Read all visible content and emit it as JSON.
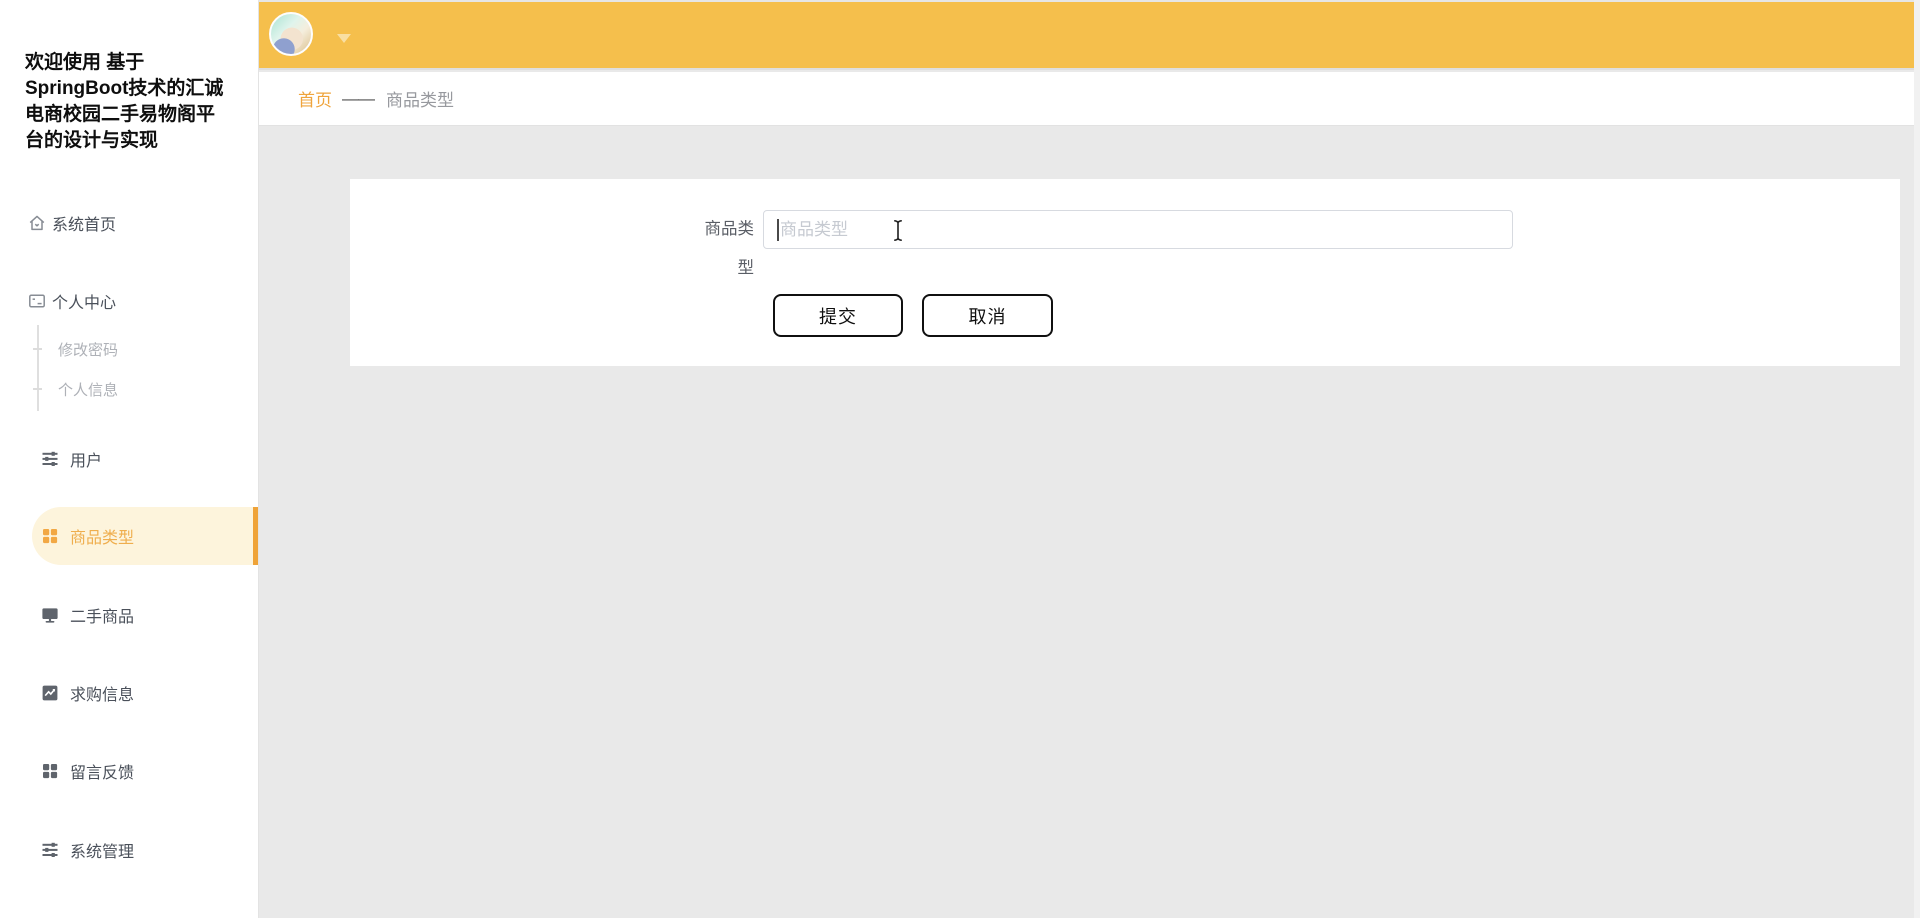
{
  "sidebar": {
    "title": "欢迎使用 基于SpringBoot技术的汇诚电商校园二手易物阁平台的设计与实现",
    "items": [
      {
        "label": "系统首页",
        "icon": "home-icon"
      },
      {
        "label": "个人中心",
        "icon": "postcard-icon",
        "children": [
          "修改密码",
          "个人信息"
        ]
      },
      {
        "label": "用户",
        "icon": "operation-icon"
      },
      {
        "label": "商品类型",
        "icon": "grid-menu-icon",
        "active": true
      },
      {
        "label": "二手商品",
        "icon": "monitor-icon"
      },
      {
        "label": "求购信息",
        "icon": "trend-chart-icon"
      },
      {
        "label": "留言反馈",
        "icon": "grid-menu-icon"
      },
      {
        "label": "系统管理",
        "icon": "operation-icon"
      }
    ]
  },
  "header": {
    "avatar": "user-avatar",
    "dropdown_caret": "caret-down"
  },
  "breadcrumb": {
    "home": "首页",
    "separator": "——",
    "current": "商品类型"
  },
  "form": {
    "label": "商品类型",
    "input_value": "",
    "input_placeholder": "商品类型",
    "submit_label": "提交",
    "cancel_label": "取消"
  },
  "colors": {
    "topbar": "#F5BF4C",
    "active_pill_bg": "#FDF4DC",
    "active_text": "#EFAE4E",
    "accent_bar": "#EFA338",
    "breadcrumb_active": "#EFA43C",
    "content_bg": "#E9E9E9"
  }
}
